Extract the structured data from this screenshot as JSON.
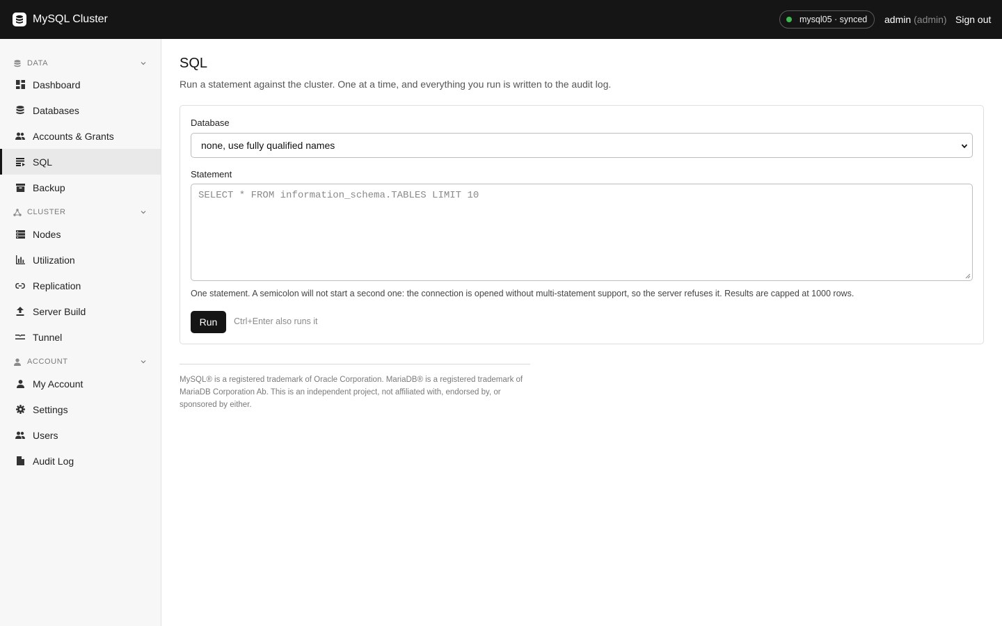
{
  "app": {
    "title": "MySQL Cluster",
    "status": "mysql05 · synced",
    "user": "admin",
    "role": "(admin)",
    "sign_out": "Sign out",
    "colors": {
      "topbar": "#151515",
      "status_ok": "#3fb950",
      "primary_button": "#151515"
    }
  },
  "sidebar": {
    "sections": [
      {
        "title": "DATA",
        "icon": "database-icon",
        "items": [
          {
            "label": "Dashboard",
            "icon": "dashboard-icon"
          },
          {
            "label": "Databases",
            "icon": "database-icon"
          },
          {
            "label": "Accounts & Grants",
            "icon": "people-icon"
          },
          {
            "label": "SQL",
            "icon": "sql-icon",
            "active": true
          },
          {
            "label": "Backup",
            "icon": "archive-icon"
          }
        ]
      },
      {
        "title": "CLUSTER",
        "icon": "cluster-icon",
        "items": [
          {
            "label": "Nodes",
            "icon": "server-icon"
          },
          {
            "label": "Utilization",
            "icon": "bar-chart-icon"
          },
          {
            "label": "Replication",
            "icon": "link-icon"
          },
          {
            "label": "Server Build",
            "icon": "upload-icon"
          },
          {
            "label": "Tunnel",
            "icon": "tunnel-icon"
          }
        ]
      },
      {
        "title": "ACCOUNT",
        "icon": "person-icon",
        "items": [
          {
            "label": "My Account",
            "icon": "person-icon"
          },
          {
            "label": "Settings",
            "icon": "gear-icon"
          },
          {
            "label": "Users",
            "icon": "people-icon"
          },
          {
            "label": "Audit Log",
            "icon": "document-icon"
          }
        ]
      }
    ]
  },
  "main": {
    "title": "SQL",
    "description": "Run a statement against the cluster. One at a time, and everything you run is written to the audit log.",
    "form": {
      "database_label": "Database",
      "database_value": "none, use fully qualified names",
      "statement_label": "Statement",
      "statement_placeholder": "SELECT * FROM information_schema.TABLES LIMIT 10",
      "hint": "One statement. A semicolon will not start a second one: the connection is opened without multi-statement support, so the server refuses it. Results are capped at 1000 rows.",
      "run_label": "Run",
      "shortcut_hint": "Ctrl+Enter also runs it"
    },
    "footer": "MySQL® is a registered trademark of Oracle Corporation. MariaDB® is a registered trademark of MariaDB Corporation Ab. This is an independent project, not affiliated with, endorsed by, or sponsored by either."
  }
}
